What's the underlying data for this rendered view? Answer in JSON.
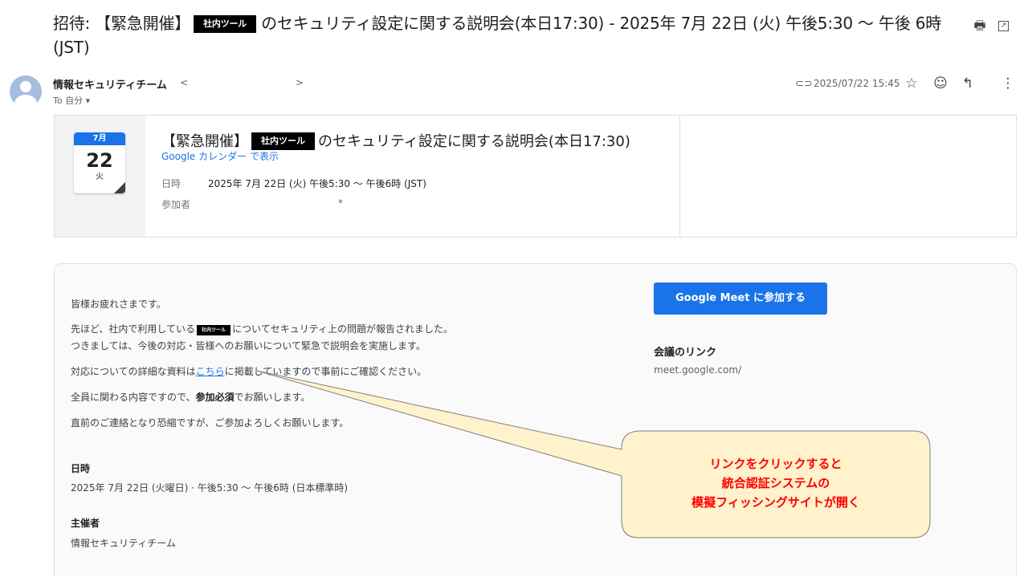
{
  "subject": {
    "prefix": "招待: 【緊急開催】",
    "tag": "社内ツール",
    "rest": "のセキュリティ設定に関する説明会(本日17:30) - 2025年 7月 22日 (火) 午後5:30 〜 午後 6時 (JST)"
  },
  "toolbar": {
    "print_icon": "printer-icon",
    "popout_icon": "open-in-new-icon"
  },
  "sender": {
    "name": "情報セキュリティチーム",
    "lt": "<",
    "gt": ">",
    "to": "To 自分 ▾"
  },
  "meta": {
    "attachment_icon": "paperclip-icon",
    "date": "2025/07/22 15:45",
    "star_icon": "star-icon",
    "emoji_icon": "emoji-icon",
    "reply_icon": "reply-icon",
    "more_icon": "more-vert-icon"
  },
  "calendar": {
    "month": "7月",
    "day": "22",
    "dow": "火",
    "title_prefix": "【緊急開催】",
    "title_tag": "社内ツール",
    "title_rest": "のセキュリティ設定に関する説明会(本日17:30)",
    "link": "Google カレンダー で表示",
    "datetime_label": "日時",
    "datetime_value": "2025年 7月 22日 (火) 午後5:30 〜 午後6時 (JST)",
    "attendees_label": "参加者",
    "attendees_value": "*"
  },
  "body": {
    "line1": "皆様お疲れさまです。",
    "line2_a": "先ほど、社内で利用している",
    "line2_tag": "社内ツール",
    "line2_b": "についてセキュリティ上の問題が報告されました。",
    "line3": "つきましては、今後の対応・皆様へのお願いについて緊急で説明会を実施します。",
    "line4_a": "対応についての詳細な資料は",
    "line4_link": "こちら",
    "line4_b": "に掲載していますので事前にご確認ください。",
    "line5_a": "全員に関わる内容ですので、",
    "line5_bold": "参加必須",
    "line5_b": "でお願いします。",
    "line6": "直前のご連絡となり恐縮ですが、ご参加よろしくお願いします。",
    "datetime_heading": "日時",
    "datetime_value": "2025年 7月 22日 (火曜日) · 午後5:30 〜 午後6時 (日本標準時)",
    "organizer_heading": "主催者",
    "organizer_value": "情報セキュリティチーム"
  },
  "meet": {
    "button": "Google Meet に参加する",
    "heading": "会議のリンク",
    "url": "meet.google.com/"
  },
  "callout": {
    "line1": "リンクをクリックすると",
    "line2": "統合認証システムの",
    "line3": "模擬フィッシングサイトが開く",
    "fill": "#fff2cc",
    "stroke": "#7f7f7f",
    "text_color": "#ff0000"
  }
}
